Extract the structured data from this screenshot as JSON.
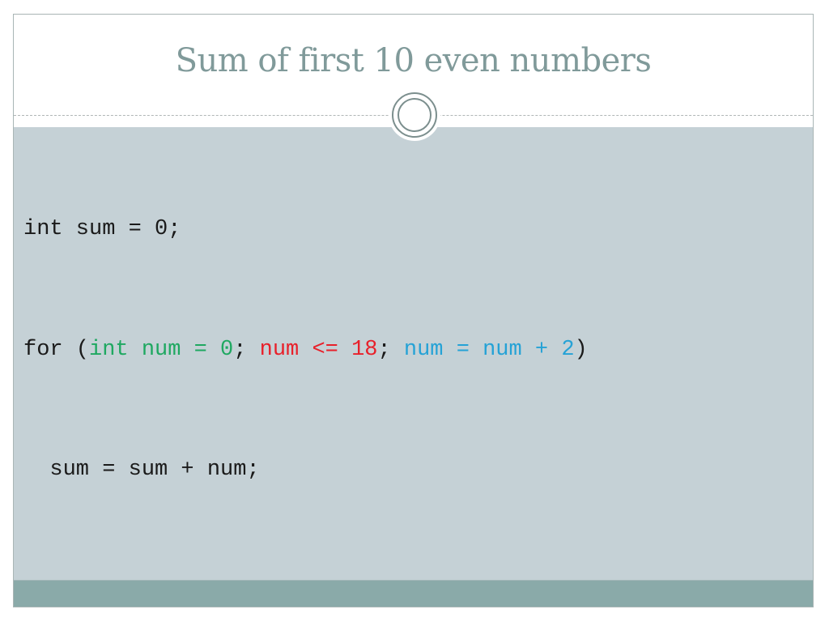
{
  "slide": {
    "title": "Sum of first 10 even numbers",
    "colors": {
      "title": "#809a9a",
      "body_background": "#c5d1d6",
      "footer": "#8aaaa9",
      "init": "#1fa861",
      "condition": "#e8202a",
      "update": "#25a2d6"
    },
    "code": {
      "line1": "int sum = 0;",
      "line2": {
        "prefix": "for (",
        "init": "int num = 0",
        "sep1": "; ",
        "condition": "num <= 18",
        "sep2": "; ",
        "update": "num = num + 2",
        "suffix": ")"
      },
      "line3": "  sum = sum + num;"
    }
  }
}
